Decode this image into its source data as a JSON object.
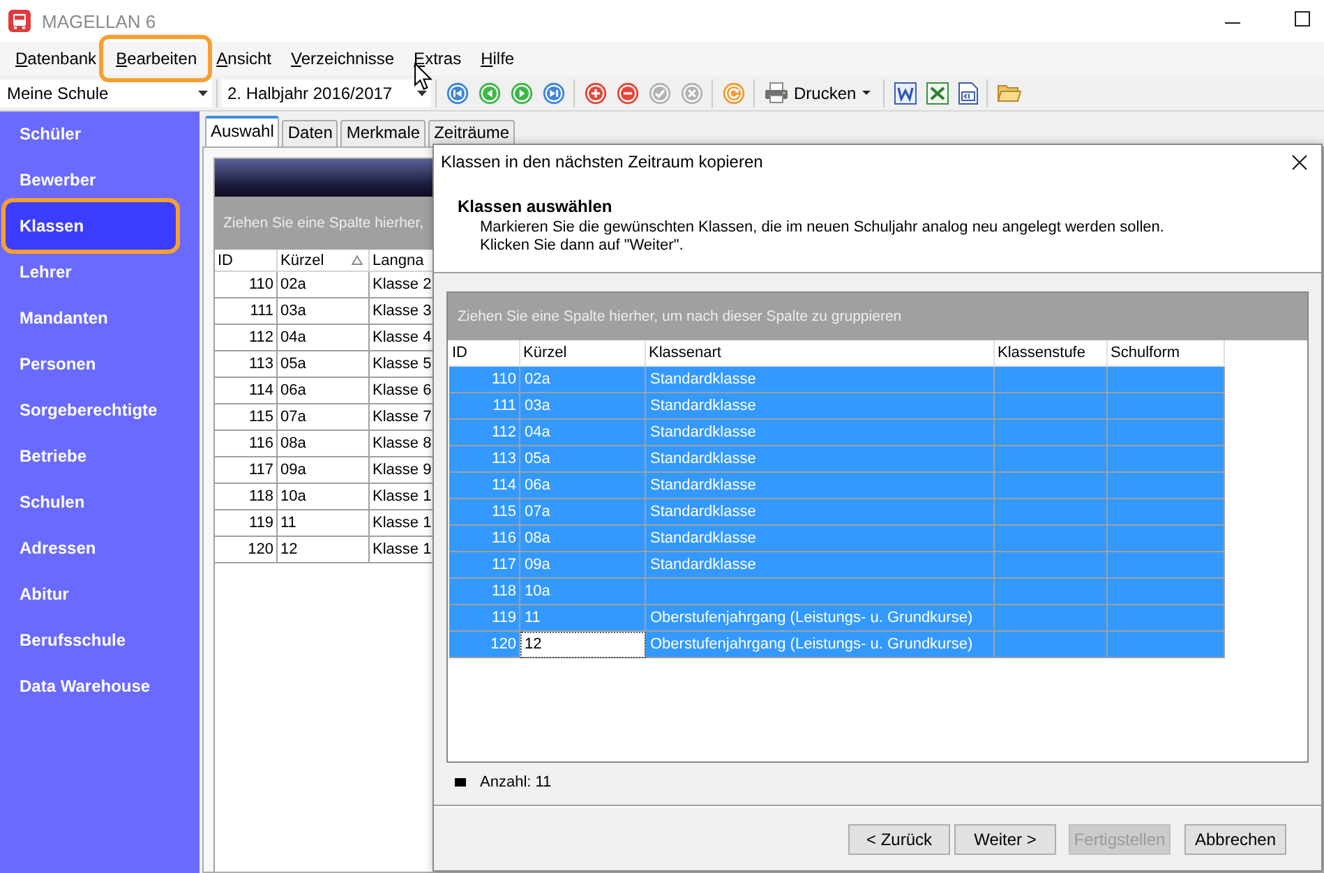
{
  "window": {
    "title": "MAGELLAN 6"
  },
  "menu": [
    {
      "label": "Datenbank",
      "highlighted": false
    },
    {
      "label": "Bearbeiten",
      "highlighted": true
    },
    {
      "label": "Ansicht",
      "highlighted": false
    },
    {
      "label": "Verzeichnisse",
      "highlighted": false
    },
    {
      "label": "Extras",
      "highlighted": false
    },
    {
      "label": "Hilfe",
      "highlighted": false
    }
  ],
  "toolbar": {
    "school": "Meine Schule",
    "period": "2. Halbjahr 2016/2017",
    "record_buttons": [
      {
        "disabled": false
      },
      {
        "disabled": false
      },
      {
        "disabled": false
      },
      {
        "disabled": false
      },
      {
        "disabled": false
      },
      {
        "disabled": false
      },
      {
        "disabled": true
      },
      {
        "disabled": true
      }
    ],
    "print_button": "Drucken"
  },
  "sidebar": {
    "items": [
      {
        "label": "Schüler",
        "selected": false,
        "highlighted": false
      },
      {
        "label": "Bewerber",
        "selected": false,
        "highlighted": false
      },
      {
        "label": "Klassen",
        "selected": true,
        "highlighted": true
      },
      {
        "label": "Lehrer",
        "selected": false,
        "highlighted": false
      },
      {
        "label": "Mandanten",
        "selected": false,
        "highlighted": false
      },
      {
        "label": "Personen",
        "selected": false,
        "highlighted": false
      },
      {
        "label": "Sorgeberechtigte",
        "selected": false,
        "highlighted": false
      },
      {
        "label": "Betriebe",
        "selected": false,
        "highlighted": false
      },
      {
        "label": "Schulen",
        "selected": false,
        "highlighted": false
      },
      {
        "label": "Adressen",
        "selected": false,
        "highlighted": false
      },
      {
        "label": "Abitur",
        "selected": false,
        "highlighted": false
      },
      {
        "label": "Berufsschule",
        "selected": false,
        "highlighted": false
      },
      {
        "label": "Data Warehouse",
        "selected": false,
        "highlighted": false
      }
    ]
  },
  "tabs": [
    {
      "label": "Auswahl",
      "selected": true
    },
    {
      "label": "Daten",
      "selected": false
    },
    {
      "label": "Merkmale",
      "selected": false
    },
    {
      "label": "Zeiträume",
      "selected": false
    }
  ],
  "class_list": {
    "group_hint": "Ziehen Sie eine Spalte hierher,",
    "columns": [
      {
        "label": "ID",
        "sorted": false
      },
      {
        "label": "Kürzel",
        "sorted": true
      },
      {
        "label": "Langna",
        "sorted": false
      }
    ],
    "rows": [
      {
        "id": "110",
        "code": "02a",
        "name": "Klasse 2"
      },
      {
        "id": "111",
        "code": "03a",
        "name": "Klasse 3"
      },
      {
        "id": "112",
        "code": "04a",
        "name": "Klasse 4"
      },
      {
        "id": "113",
        "code": "05a",
        "name": "Klasse 5"
      },
      {
        "id": "114",
        "code": "06a",
        "name": "Klasse 6"
      },
      {
        "id": "115",
        "code": "07a",
        "name": "Klasse 7"
      },
      {
        "id": "116",
        "code": "08a",
        "name": "Klasse 8"
      },
      {
        "id": "117",
        "code": "09a",
        "name": "Klasse 9"
      },
      {
        "id": "118",
        "code": "10a",
        "name": "Klasse 1"
      },
      {
        "id": "119",
        "code": "11",
        "name": "Klasse 1"
      },
      {
        "id": "120",
        "code": "12",
        "name": "Klasse 1"
      }
    ]
  },
  "dialog": {
    "title": "Klassen in den nächsten Zeitraum kopieren",
    "heading": "Klassen auswählen",
    "instructions": [
      "Markieren Sie die gewünschten Klassen, die im neuen Schuljahr analog neu angelegt werden sollen.",
      "Klicken Sie dann auf \"Weiter\"."
    ],
    "grid": {
      "group_hint": "Ziehen Sie eine Spalte hierher, um nach dieser Spalte zu gruppieren",
      "columns": [
        "ID",
        "Kürzel",
        "Klassenart",
        "Klassenstufe",
        "Schulform"
      ],
      "rows": [
        {
          "id": "110",
          "code": "02a",
          "type": "Standardklasse",
          "selected": true,
          "focused": false
        },
        {
          "id": "111",
          "code": "03a",
          "type": "Standardklasse",
          "selected": true,
          "focused": false
        },
        {
          "id": "112",
          "code": "04a",
          "type": "Standardklasse",
          "selected": true,
          "focused": false
        },
        {
          "id": "113",
          "code": "05a",
          "type": "Standardklasse",
          "selected": true,
          "focused": false
        },
        {
          "id": "114",
          "code": "06a",
          "type": "Standardklasse",
          "selected": true,
          "focused": false
        },
        {
          "id": "115",
          "code": "07a",
          "type": "Standardklasse",
          "selected": true,
          "focused": false
        },
        {
          "id": "116",
          "code": "08a",
          "type": "Standardklasse",
          "selected": true,
          "focused": false
        },
        {
          "id": "117",
          "code": "09a",
          "type": "Standardklasse",
          "selected": true,
          "focused": false
        },
        {
          "id": "118",
          "code": "10a",
          "selected": true,
          "focused": false
        },
        {
          "id": "119",
          "code": "11",
          "type": "Oberstufenjahrgang (Leistungs- u. Grundkurse)",
          "selected": true,
          "focused": false
        },
        {
          "id": "120",
          "code": "12",
          "type": "Oberstufenjahrgang (Leistungs- u. Grundkurse)",
          "selected": true,
          "focused": true
        }
      ]
    },
    "count": "Anzahl: 11",
    "buttons": [
      {
        "label": "< Zurück",
        "disabled": false
      },
      {
        "label": "Weiter >",
        "disabled": false
      },
      {
        "label": "Fertigstellen",
        "disabled": true
      },
      {
        "label": "Abbrechen",
        "disabled": false
      }
    ]
  }
}
